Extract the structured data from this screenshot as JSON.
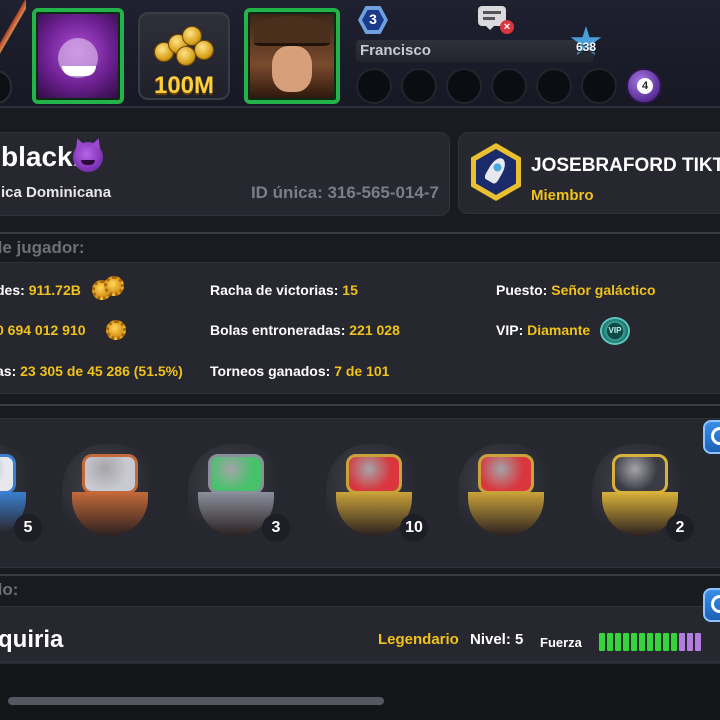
{
  "header": {
    "coins_amount": "100M",
    "level": "3",
    "friend_name": "Francisco",
    "friend_rank": "638",
    "ball_count": "4"
  },
  "profile": {
    "name": "black.",
    "country": "ica Dominicana",
    "id_text": "ID única: 316-565-014-7"
  },
  "club": {
    "name": "JOSEBRAFORD TIKT",
    "role": "Miembro"
  },
  "stats_section_title": "de jugador:",
  "stats": {
    "col1": [
      {
        "label": "des: ",
        "value": "911.72B"
      },
      {
        "label": "",
        "value": "0 694 012 910"
      },
      {
        "label": "as: ",
        "value": "23 305 de 45 286 (51.5%)"
      }
    ],
    "col2": [
      {
        "label": "Racha de victorias: ",
        "value": "15"
      },
      {
        "label": "Bolas entroneradas: ",
        "value": "221 028"
      },
      {
        "label": "Torneos ganados: ",
        "value": "7 de 101"
      }
    ],
    "col3": [
      {
        "label": "Puesto: ",
        "value": "Señor galáctico"
      },
      {
        "label": "VIP: ",
        "value": "Diamante"
      }
    ],
    "vip_badge": "VIP"
  },
  "rings": [
    {
      "name": "partial-ring",
      "count": "5",
      "stone": "#e7e7ee",
      "band": "#3a7fd0"
    },
    {
      "name": "microphone-ring",
      "count": "",
      "stone": "#c9c9d1",
      "band": "#c46a3a"
    },
    {
      "name": "spirit-ring",
      "count": "3",
      "stone": "#47c26a",
      "band": "#8a8f9c"
    },
    {
      "name": "diamonds-ring",
      "count": "10",
      "stone": "#d9363e",
      "band": "#c9a23a"
    },
    {
      "name": "hearts-ring",
      "count": "",
      "stone": "#d9363e",
      "band": "#c9a23a"
    },
    {
      "name": "spades-ring",
      "count": "2",
      "stone": "#3a3b45",
      "band": "#d9b23a"
    }
  ],
  "league_section_title": "do:",
  "league": {
    "name": "quiria",
    "rank": "Legendario",
    "level": "Nivel: 5",
    "force_label": "Fuerza",
    "force_filled": 10,
    "force_total": 13
  }
}
